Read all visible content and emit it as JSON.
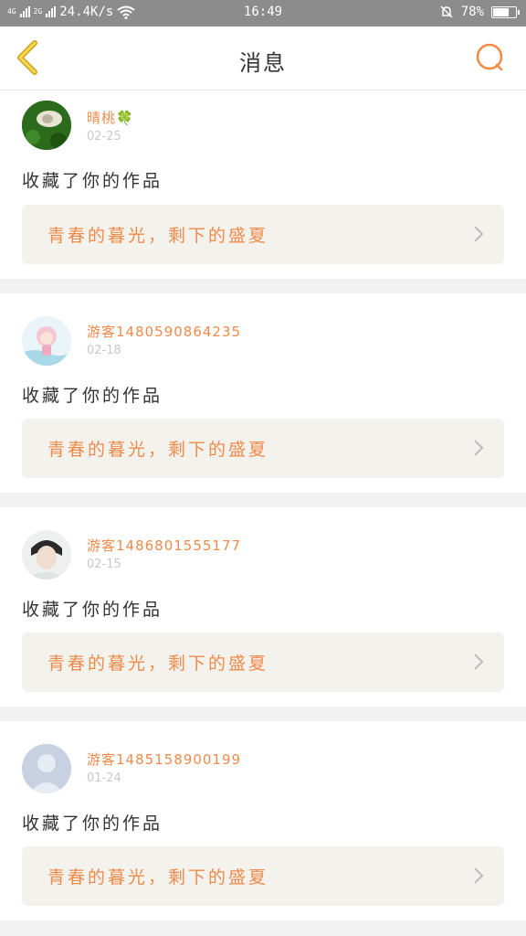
{
  "status_bar": {
    "network_4g": "4G",
    "network_2g": "2G",
    "speed": "24.4K/s",
    "time": "16:49",
    "battery": "78%",
    "battery_level": 0.78
  },
  "header": {
    "title": "消息"
  },
  "notifications": [
    {
      "username": "晴桃🍀",
      "date": "02-25",
      "action": "收藏了你的作品",
      "work_title": "青春的暮光，剩下的盛夏"
    },
    {
      "username": "游客1480590864235",
      "date": "02-18",
      "action": "收藏了你的作品",
      "work_title": "青春的暮光，剩下的盛夏"
    },
    {
      "username": "游客1486801555177",
      "date": "02-15",
      "action": "收藏了你的作品",
      "work_title": "青春的暮光，剩下的盛夏"
    },
    {
      "username": "游客1485158900199",
      "date": "01-24",
      "action": "收藏了你的作品",
      "work_title": "青春的暮光，剩下的盛夏"
    }
  ],
  "colors": {
    "accent": "#f08a4b",
    "back_arrow": "#e8b300",
    "card_link_bg": "#f3f2ec"
  }
}
